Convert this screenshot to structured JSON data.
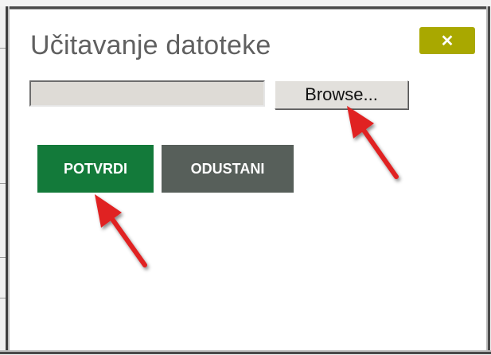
{
  "dialog": {
    "title": "Učitavanje datoteke",
    "close_label": "✕",
    "file_input": {
      "value": "",
      "browse_label": "Browse..."
    },
    "confirm_label": "POTVRDI",
    "cancel_label": "ODUSTANI"
  },
  "colors": {
    "close_button": "#a9a800",
    "confirm_button": "#137a3a",
    "cancel_button": "#575f5a",
    "annotation_arrow": "#e02020"
  },
  "icons": {
    "close": "close-icon",
    "annotation": "red-arrow-annotation"
  }
}
